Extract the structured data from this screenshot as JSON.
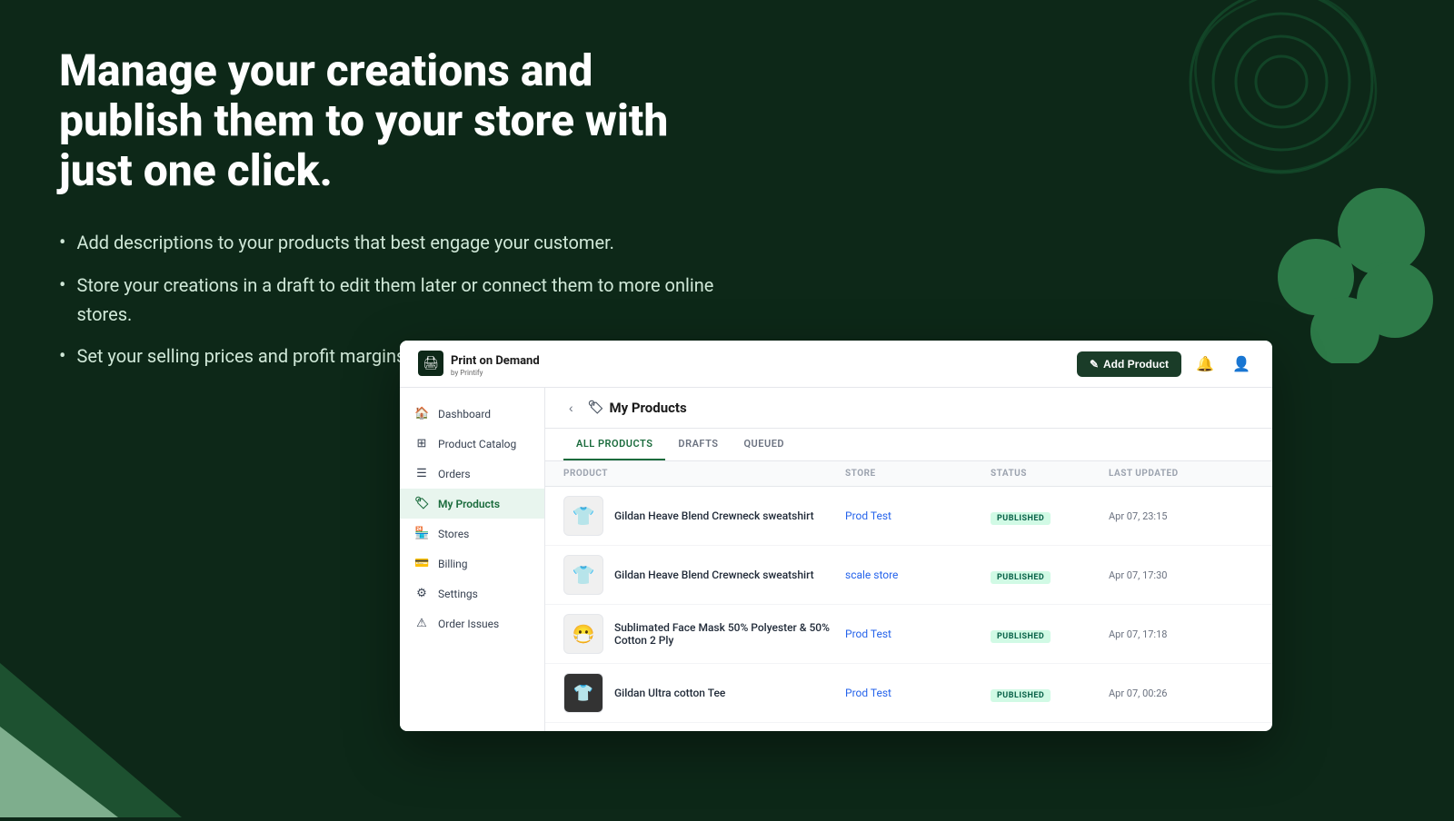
{
  "hero": {
    "title": "Manage your creations and publish them to your store with just one click.",
    "bullets": [
      "Add descriptions to your products that best engage your customer.",
      "Store your creations in a draft to edit them later or connect them to more online stores.",
      "Set your selling prices and profit margins."
    ]
  },
  "dashboard": {
    "logo_text": "Print on Demand",
    "logo_sub": "by Printify",
    "add_product_btn": "Add Product",
    "sidebar": {
      "items": [
        {
          "label": "Dashboard",
          "icon": "🏠",
          "active": false
        },
        {
          "label": "Product Catalog",
          "icon": "⊞",
          "active": false
        },
        {
          "label": "Orders",
          "icon": "☰",
          "active": false
        },
        {
          "label": "My Products",
          "icon": "🏷",
          "active": true
        },
        {
          "label": "Stores",
          "icon": "🏪",
          "active": false
        },
        {
          "label": "Billing",
          "icon": "💳",
          "active": false
        },
        {
          "label": "Settings",
          "icon": "⚙",
          "active": false
        },
        {
          "label": "Order Issues",
          "icon": "⚠",
          "active": false
        }
      ]
    },
    "page_title": "My Products",
    "tabs": [
      {
        "label": "All Products",
        "active": true
      },
      {
        "label": "Drafts",
        "active": false
      },
      {
        "label": "Queued",
        "active": false
      }
    ],
    "table": {
      "headers": [
        "Product",
        "Store",
        "Status",
        "Last Updated"
      ],
      "rows": [
        {
          "thumb": "👕",
          "name": "Gildan Heave Blend Crewneck sweatshirt",
          "store": "Prod Test",
          "status": "PUBLISHED",
          "updated": "Apr 07, 23:15"
        },
        {
          "thumb": "👕",
          "name": "Gildan Heave Blend Crewneck sweatshirt",
          "store": "scale store",
          "status": "PUBLISHED",
          "updated": "Apr 07, 17:30"
        },
        {
          "thumb": "😷",
          "name": "Sublimated Face Mask 50% Polyester & 50% Cotton 2 Ply",
          "store": "Prod Test",
          "status": "PUBLISHED",
          "updated": "Apr 07, 17:18"
        },
        {
          "thumb": "👕",
          "name": "Gildan Ultra cotton Tee",
          "store": "Prod Test",
          "status": "PUBLISHED",
          "updated": "Apr 07, 00:26"
        }
      ]
    }
  },
  "colors": {
    "bg_dark": "#0d2818",
    "accent_green": "#1a6b3c",
    "published_bg": "#d1fae5",
    "published_text": "#065f46"
  }
}
